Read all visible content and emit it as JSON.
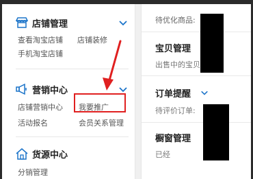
{
  "sidebar": {
    "store": {
      "title": "店铺管理",
      "icon": "store-icon",
      "links": [
        "查看淘宝店铺",
        "店铺装修",
        "手机淘宝店铺"
      ]
    },
    "marketing": {
      "title": "营销中心",
      "icon": "megaphone-icon",
      "links": [
        "店铺营销中心",
        "我要推广",
        "活动报名",
        "会员关系管理"
      ]
    },
    "supply": {
      "title": "货源中心",
      "icon": "house-icon",
      "links": [
        "分销管理"
      ]
    }
  },
  "main": {
    "pending_label": "待优化商品:",
    "product": {
      "title": "宝贝管理",
      "sub": "出售中的宝贝"
    },
    "order": {
      "title": "订单提醒",
      "sub": "待评价订单:"
    },
    "window": {
      "title": "橱窗管理",
      "sub": "已经"
    }
  },
  "colors": {
    "accent": "#1a73c9",
    "highlight": "#e02020"
  }
}
